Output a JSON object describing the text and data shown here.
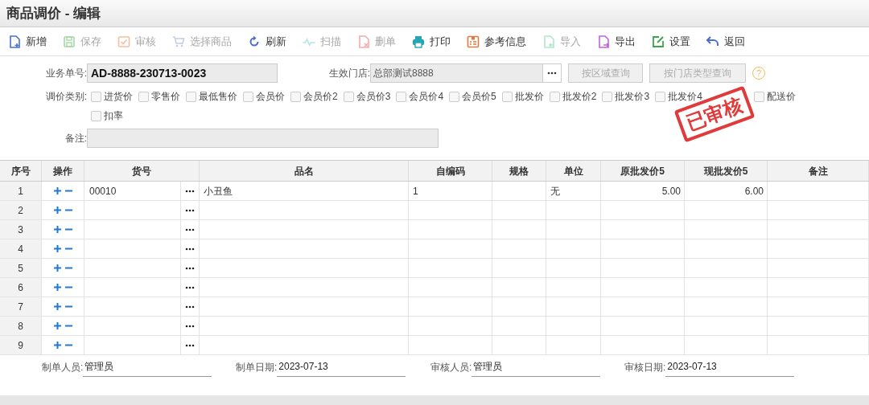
{
  "window": {
    "title": "商品调价 - 编辑"
  },
  "toolbar": [
    {
      "label": "新增",
      "kind": "new",
      "disabled": false
    },
    {
      "label": "保存",
      "kind": "save",
      "disabled": true
    },
    {
      "label": "审核",
      "kind": "approve",
      "disabled": true
    },
    {
      "label": "选择商品",
      "kind": "cart",
      "disabled": true
    },
    {
      "label": "刷新",
      "kind": "refresh",
      "disabled": false
    },
    {
      "label": "扫描",
      "kind": "scan",
      "disabled": true
    },
    {
      "label": "删单",
      "kind": "delete",
      "disabled": true
    },
    {
      "label": "打印",
      "kind": "print",
      "disabled": false
    },
    {
      "label": "参考信息",
      "kind": "info",
      "disabled": false
    },
    {
      "label": "导入",
      "kind": "import",
      "disabled": true
    },
    {
      "label": "导出",
      "kind": "export",
      "disabled": false
    },
    {
      "label": "设置",
      "kind": "settings",
      "disabled": false
    },
    {
      "label": "返回",
      "kind": "back",
      "disabled": false
    }
  ],
  "form": {
    "doc_no": {
      "label": "业务单号:",
      "value": "AD-8888-230713-0023"
    },
    "store": {
      "label": "生效门店:",
      "value": "总部测试8888"
    },
    "buttons": [
      "按区域查询",
      "按门店类型查询"
    ],
    "help": "?",
    "price_types": {
      "label": "调价类别:",
      "options": [
        {
          "label": "进货价",
          "checked": false
        },
        {
          "label": "零售价",
          "checked": false
        },
        {
          "label": "最低售价",
          "checked": false
        },
        {
          "label": "会员价",
          "checked": false
        },
        {
          "label": "会员价2",
          "checked": false
        },
        {
          "label": "会员价3",
          "checked": false
        },
        {
          "label": "会员价4",
          "checked": false
        },
        {
          "label": "会员价5",
          "checked": false
        },
        {
          "label": "批发价",
          "checked": false
        },
        {
          "label": "批发价2",
          "checked": false
        },
        {
          "label": "批发价3",
          "checked": false
        },
        {
          "label": "批发价4",
          "checked": false
        },
        {
          "label": "配送价",
          "checked": false
        },
        {
          "label": "扣率",
          "checked": false
        }
      ]
    },
    "remark": {
      "label": "备注:"
    }
  },
  "stamp": "已审核",
  "table": {
    "columns": [
      "序号",
      "操作",
      "货号",
      "品名",
      "自编码",
      "规格",
      "单位",
      "原批发价5",
      "现批发价5",
      "备注"
    ],
    "rows": [
      {
        "no": "1",
        "item_no": "00010",
        "name": "小丑鱼",
        "code": "1",
        "unit": "无",
        "old_price": "5.00",
        "new_price": "6.00"
      },
      {
        "no": "2"
      },
      {
        "no": "3"
      },
      {
        "no": "4"
      },
      {
        "no": "5"
      },
      {
        "no": "6"
      },
      {
        "no": "7"
      },
      {
        "no": "8"
      },
      {
        "no": "9"
      }
    ]
  },
  "footer": [
    {
      "label": "制单人员:",
      "value": "管理员"
    },
    {
      "label": "制单日期:",
      "value": "2023-07-13"
    },
    {
      "label": "审核人员:",
      "value": "管理员"
    },
    {
      "label": "审核日期:",
      "value": "2023-07-13"
    }
  ]
}
